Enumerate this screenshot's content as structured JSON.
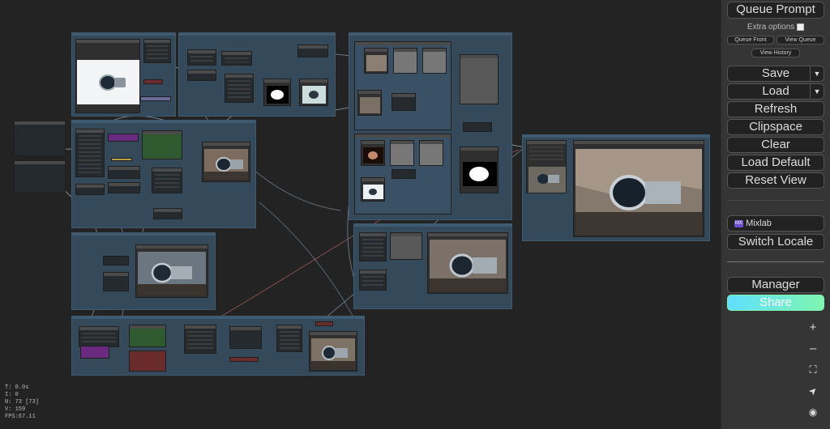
{
  "sidebar": {
    "queue_prompt": "Queue Prompt",
    "extra_options": "Extra options",
    "queue_front": "Queue Front",
    "view_queue": "View Queue",
    "view_history": "View History",
    "save": "Save",
    "load": "Load",
    "refresh": "Refresh",
    "clipspace": "Clipspace",
    "clear": "Clear",
    "load_default": "Load Default",
    "reset_view": "Reset View",
    "mixlab": "Mixlab",
    "mixlab_badge": "MX",
    "switch_locale": "Switch Locale",
    "manager": "Manager",
    "share": "Share",
    "dropdown_arrow": "▼",
    "zoom_in": "+",
    "zoom_out": "–",
    "fit_view": "⛶",
    "locate": "➤",
    "toggle_visibility": "◉"
  },
  "stats": {
    "t": "T: 0.0s",
    "i": "I: 0",
    "n": "N: 73 [73]",
    "v": "V: 159",
    "fps": "FPS:67.11"
  },
  "colors": {
    "share_gradient_start": "#5ee0ff",
    "share_gradient_end": "#7ff5b0",
    "group_fill": "#34495a",
    "mixlab_badge": "#6d4dd8"
  }
}
